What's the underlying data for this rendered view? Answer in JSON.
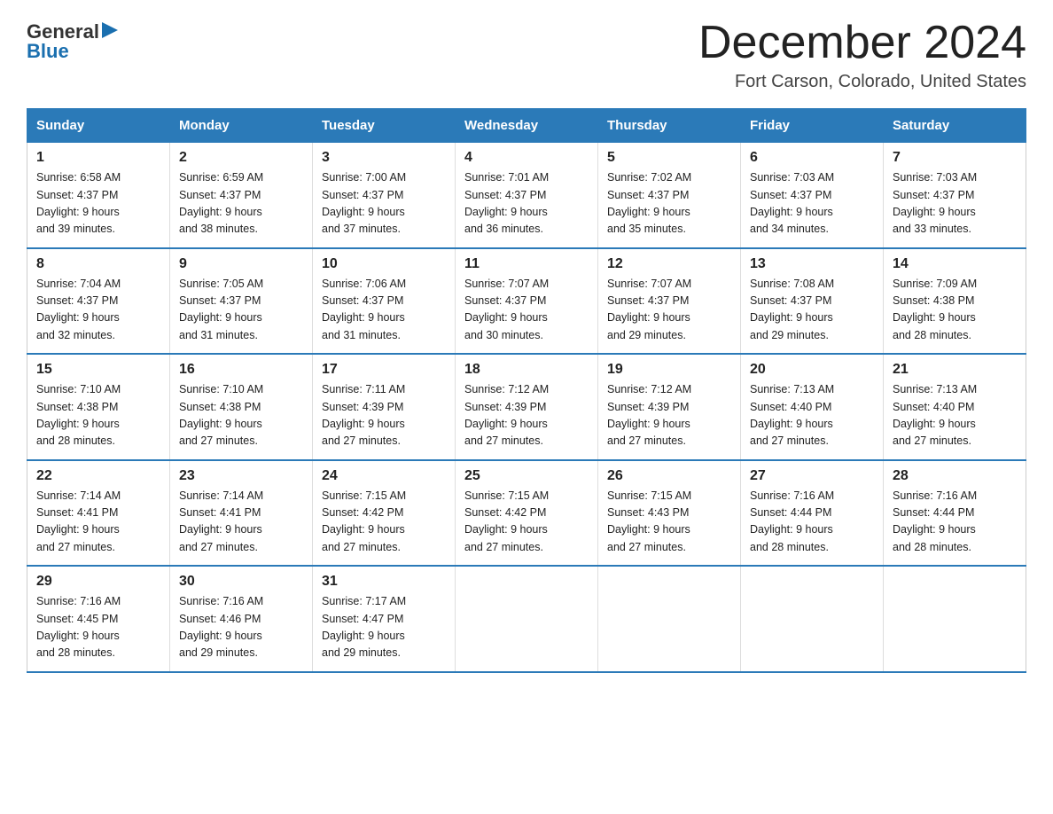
{
  "header": {
    "logo_text1": "General",
    "logo_text2": "Blue",
    "month_title": "December 2024",
    "location": "Fort Carson, Colorado, United States"
  },
  "days_of_week": [
    "Sunday",
    "Monday",
    "Tuesday",
    "Wednesday",
    "Thursday",
    "Friday",
    "Saturday"
  ],
  "weeks": [
    [
      {
        "num": "1",
        "info": "Sunrise: 6:58 AM\nSunset: 4:37 PM\nDaylight: 9 hours\nand 39 minutes."
      },
      {
        "num": "2",
        "info": "Sunrise: 6:59 AM\nSunset: 4:37 PM\nDaylight: 9 hours\nand 38 minutes."
      },
      {
        "num": "3",
        "info": "Sunrise: 7:00 AM\nSunset: 4:37 PM\nDaylight: 9 hours\nand 37 minutes."
      },
      {
        "num": "4",
        "info": "Sunrise: 7:01 AM\nSunset: 4:37 PM\nDaylight: 9 hours\nand 36 minutes."
      },
      {
        "num": "5",
        "info": "Sunrise: 7:02 AM\nSunset: 4:37 PM\nDaylight: 9 hours\nand 35 minutes."
      },
      {
        "num": "6",
        "info": "Sunrise: 7:03 AM\nSunset: 4:37 PM\nDaylight: 9 hours\nand 34 minutes."
      },
      {
        "num": "7",
        "info": "Sunrise: 7:03 AM\nSunset: 4:37 PM\nDaylight: 9 hours\nand 33 minutes."
      }
    ],
    [
      {
        "num": "8",
        "info": "Sunrise: 7:04 AM\nSunset: 4:37 PM\nDaylight: 9 hours\nand 32 minutes."
      },
      {
        "num": "9",
        "info": "Sunrise: 7:05 AM\nSunset: 4:37 PM\nDaylight: 9 hours\nand 31 minutes."
      },
      {
        "num": "10",
        "info": "Sunrise: 7:06 AM\nSunset: 4:37 PM\nDaylight: 9 hours\nand 31 minutes."
      },
      {
        "num": "11",
        "info": "Sunrise: 7:07 AM\nSunset: 4:37 PM\nDaylight: 9 hours\nand 30 minutes."
      },
      {
        "num": "12",
        "info": "Sunrise: 7:07 AM\nSunset: 4:37 PM\nDaylight: 9 hours\nand 29 minutes."
      },
      {
        "num": "13",
        "info": "Sunrise: 7:08 AM\nSunset: 4:37 PM\nDaylight: 9 hours\nand 29 minutes."
      },
      {
        "num": "14",
        "info": "Sunrise: 7:09 AM\nSunset: 4:38 PM\nDaylight: 9 hours\nand 28 minutes."
      }
    ],
    [
      {
        "num": "15",
        "info": "Sunrise: 7:10 AM\nSunset: 4:38 PM\nDaylight: 9 hours\nand 28 minutes."
      },
      {
        "num": "16",
        "info": "Sunrise: 7:10 AM\nSunset: 4:38 PM\nDaylight: 9 hours\nand 27 minutes."
      },
      {
        "num": "17",
        "info": "Sunrise: 7:11 AM\nSunset: 4:39 PM\nDaylight: 9 hours\nand 27 minutes."
      },
      {
        "num": "18",
        "info": "Sunrise: 7:12 AM\nSunset: 4:39 PM\nDaylight: 9 hours\nand 27 minutes."
      },
      {
        "num": "19",
        "info": "Sunrise: 7:12 AM\nSunset: 4:39 PM\nDaylight: 9 hours\nand 27 minutes."
      },
      {
        "num": "20",
        "info": "Sunrise: 7:13 AM\nSunset: 4:40 PM\nDaylight: 9 hours\nand 27 minutes."
      },
      {
        "num": "21",
        "info": "Sunrise: 7:13 AM\nSunset: 4:40 PM\nDaylight: 9 hours\nand 27 minutes."
      }
    ],
    [
      {
        "num": "22",
        "info": "Sunrise: 7:14 AM\nSunset: 4:41 PM\nDaylight: 9 hours\nand 27 minutes."
      },
      {
        "num": "23",
        "info": "Sunrise: 7:14 AM\nSunset: 4:41 PM\nDaylight: 9 hours\nand 27 minutes."
      },
      {
        "num": "24",
        "info": "Sunrise: 7:15 AM\nSunset: 4:42 PM\nDaylight: 9 hours\nand 27 minutes."
      },
      {
        "num": "25",
        "info": "Sunrise: 7:15 AM\nSunset: 4:42 PM\nDaylight: 9 hours\nand 27 minutes."
      },
      {
        "num": "26",
        "info": "Sunrise: 7:15 AM\nSunset: 4:43 PM\nDaylight: 9 hours\nand 27 minutes."
      },
      {
        "num": "27",
        "info": "Sunrise: 7:16 AM\nSunset: 4:44 PM\nDaylight: 9 hours\nand 28 minutes."
      },
      {
        "num": "28",
        "info": "Sunrise: 7:16 AM\nSunset: 4:44 PM\nDaylight: 9 hours\nand 28 minutes."
      }
    ],
    [
      {
        "num": "29",
        "info": "Sunrise: 7:16 AM\nSunset: 4:45 PM\nDaylight: 9 hours\nand 28 minutes."
      },
      {
        "num": "30",
        "info": "Sunrise: 7:16 AM\nSunset: 4:46 PM\nDaylight: 9 hours\nand 29 minutes."
      },
      {
        "num": "31",
        "info": "Sunrise: 7:17 AM\nSunset: 4:47 PM\nDaylight: 9 hours\nand 29 minutes."
      },
      {
        "num": "",
        "info": ""
      },
      {
        "num": "",
        "info": ""
      },
      {
        "num": "",
        "info": ""
      },
      {
        "num": "",
        "info": ""
      }
    ]
  ]
}
